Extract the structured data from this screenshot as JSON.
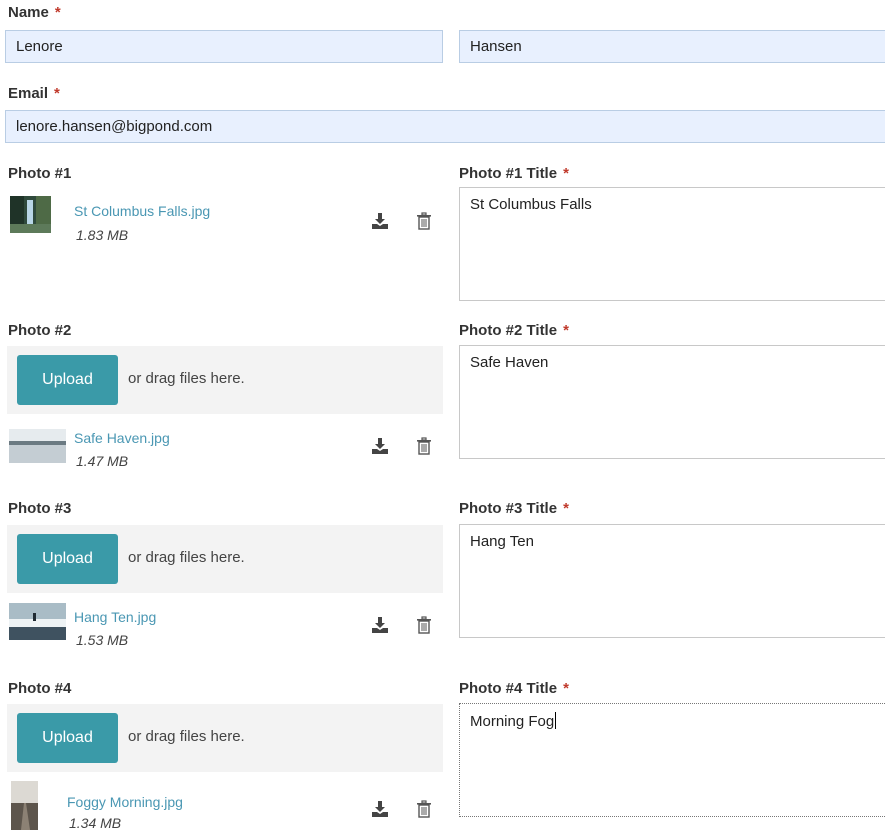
{
  "name": {
    "label": "Name",
    "required_mark": "*",
    "first": "Lenore",
    "last": "Hansen"
  },
  "email": {
    "label": "Email",
    "required_mark": "*",
    "value": "lenore.hansen@bigpond.com"
  },
  "upload_label": "Upload",
  "drag_text": "or drag files here.",
  "photos": [
    {
      "label": "Photo #1",
      "title_label": "Photo #1 Title",
      "required_mark": "*",
      "file_name": "St Columbus Falls.jpg",
      "file_size": "1.83 MB",
      "title_value": "St Columbus Falls"
    },
    {
      "label": "Photo #2",
      "title_label": "Photo #2 Title",
      "required_mark": "*",
      "file_name": "Safe Haven.jpg",
      "file_size": "1.47 MB",
      "title_value": "Safe Haven"
    },
    {
      "label": "Photo #3",
      "title_label": "Photo #3 Title",
      "required_mark": "*",
      "file_name": "Hang Ten.jpg",
      "file_size": "1.53 MB",
      "title_value": "Hang Ten"
    },
    {
      "label": "Photo #4",
      "title_label": "Photo #4 Title",
      "required_mark": "*",
      "file_name": "Foggy Morning.jpg",
      "file_size": "1.34 MB",
      "title_value": "Morning Fog"
    }
  ],
  "colors": {
    "accent": "#3a9aa8",
    "link": "#4a97b3",
    "required": "#c0392b",
    "input_fill": "#e8f0fe"
  },
  "icons": [
    "download-icon",
    "trash-icon",
    "photo-thumbnail"
  ]
}
